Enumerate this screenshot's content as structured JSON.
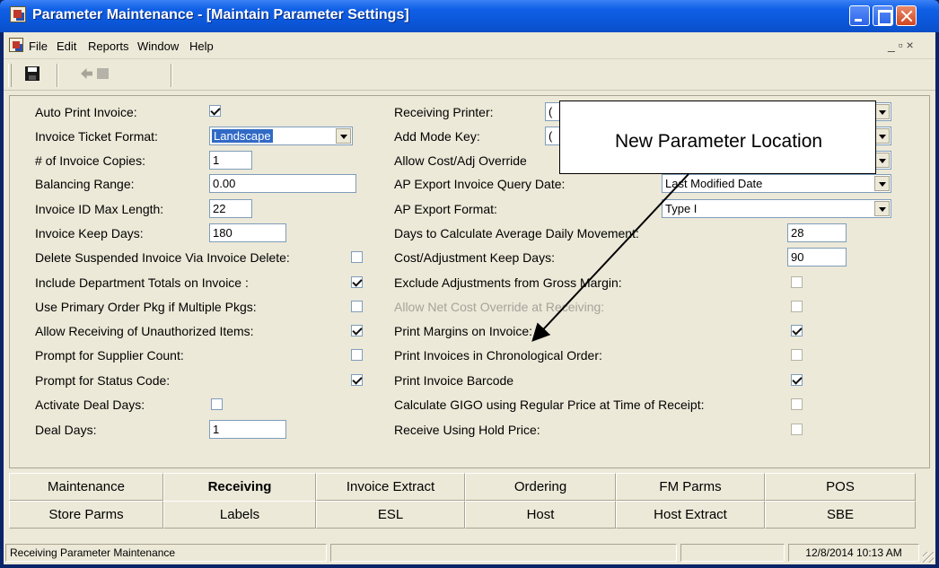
{
  "window": {
    "title": "Parameter Maintenance - [Maintain Parameter Settings]"
  },
  "menu": {
    "file": "File",
    "edit": "Edit",
    "reports": "Reports",
    "window": "Window",
    "help": "Help",
    "mdi_controls": "_ ▫ ×"
  },
  "toolbar": {
    "icons": [
      "save-icon",
      "prev-record-icon",
      "next-record-icon"
    ]
  },
  "left": {
    "auto_print_invoice": {
      "label": "Auto Print Invoice:",
      "checked": true
    },
    "invoice_ticket_format": {
      "label": "Invoice Ticket Format:",
      "value": "Landscape"
    },
    "invoice_copies": {
      "label": "# of Invoice Copies:",
      "value": "1"
    },
    "balancing_range": {
      "label": "Balancing Range:",
      "value": "0.00"
    },
    "invoice_id_max_length": {
      "label": "Invoice ID Max Length:",
      "value": "22"
    },
    "invoice_keep_days": {
      "label": "Invoice Keep Days:",
      "value": "180"
    },
    "delete_suspended": {
      "label": "Delete Suspended Invoice Via Invoice Delete:",
      "checked": false
    },
    "include_dept_totals": {
      "label": "Include Department Totals on Invoice :",
      "checked": true
    },
    "use_primary_order_pkg": {
      "label": "Use Primary Order Pkg if Multiple Pkgs:",
      "checked": false
    },
    "allow_unauthorized": {
      "label": "Allow Receiving of Unauthorized Items:",
      "checked": true
    },
    "prompt_supplier_count": {
      "label": "Prompt for Supplier Count:",
      "checked": false
    },
    "prompt_status_code": {
      "label": "Prompt for Status Code:",
      "checked": true
    },
    "activate_deal_days": {
      "label": "Activate Deal Days:",
      "checked": false
    },
    "deal_days": {
      "label": "Deal Days:",
      "value": "1"
    }
  },
  "right": {
    "receiving_printer": {
      "label": "Receiving Printer:",
      "value": "("
    },
    "add_mode_key": {
      "label": "Add Mode Key:",
      "value": "("
    },
    "allow_cost_adj_override": {
      "label": "Allow Cost/Adj Override"
    },
    "ap_export_invoice_query_date": {
      "label": "AP Export Invoice Query Date:",
      "value": "Last Modified Date"
    },
    "ap_export_format": {
      "label": "AP Export Format:",
      "value": "Type I"
    },
    "days_avg_daily_movement": {
      "label": "Days to Calculate Average Daily Movement:",
      "value": "28"
    },
    "cost_adj_keep_days": {
      "label": "Cost/Adjustment Keep Days:",
      "value": "90"
    },
    "exclude_adjustments": {
      "label": "Exclude Adjustments from Gross Margin:",
      "checked": false
    },
    "allow_net_cost_override": {
      "label": "Allow Net Cost Override at Receiving:",
      "checked": false
    },
    "print_margins": {
      "label": "Print Margins on Invoice:",
      "checked": true
    },
    "print_chronological": {
      "label": "Print Invoices in Chronological Order:",
      "checked": false
    },
    "print_invoice_barcode": {
      "label": "Print Invoice Barcode",
      "checked": true
    },
    "calculate_gigo": {
      "label": "Calculate GIGO using Regular Price at Time of Receipt:",
      "checked": false
    },
    "receive_hold_price": {
      "label": "Receive Using Hold Price:",
      "checked": false
    }
  },
  "callout": {
    "text": "New Parameter Location"
  },
  "tabs": {
    "row1": [
      "Maintenance",
      "Receiving",
      "Invoice Extract",
      "Ordering",
      "FM Parms",
      "POS"
    ],
    "row2": [
      "Store Parms",
      "Labels",
      "ESL",
      "Host",
      "Host Extract",
      "SBE"
    ],
    "active": "Receiving"
  },
  "status": {
    "message": "Receiving Parameter Maintenance",
    "datetime": "12/8/2014 10:13 AM"
  }
}
